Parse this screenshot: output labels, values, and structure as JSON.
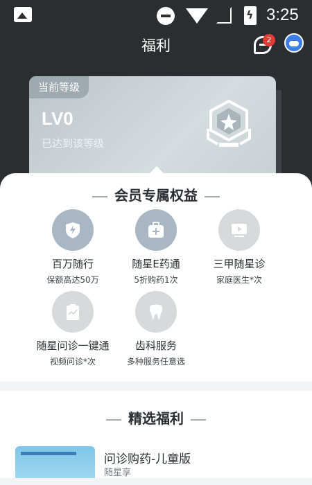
{
  "status_bar": {
    "time": "3:25"
  },
  "nav": {
    "title": "福利",
    "message_badge": "2"
  },
  "level_card": {
    "tag": "当前等级",
    "level": "LV0",
    "description": "已达到该等级"
  },
  "benefits_section": {
    "title": "会员专属权益",
    "items": [
      {
        "name": "百万随行",
        "sub": "保额高达50万",
        "icon": "bolt-shield-icon"
      },
      {
        "name": "随星E药通",
        "sub": "5折购药1次",
        "icon": "medical-kit-icon"
      },
      {
        "name": "三甲随星诊",
        "sub": "家庭医生*次",
        "icon": "video-screen-icon"
      },
      {
        "name": "随星问诊一键通",
        "sub": "视频问诊*次",
        "icon": "clipboard-chart-icon"
      },
      {
        "name": "齿科服务",
        "sub": "多种服务任意选",
        "icon": "tooth-icon"
      }
    ]
  },
  "featured_section": {
    "title": "精选福利",
    "items": [
      {
        "title": "问诊购药-儿童版",
        "sub": "随星享"
      }
    ]
  },
  "colors": {
    "header_bg": "#2a2e31",
    "badge_red": "#e53935",
    "accent_blue": "#3b7ee4"
  }
}
